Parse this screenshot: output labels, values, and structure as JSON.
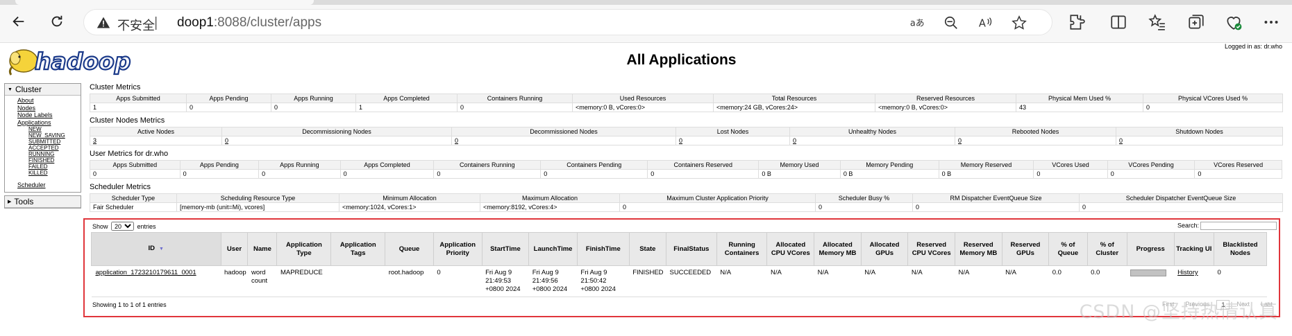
{
  "browser": {
    "insecure_label": "不安全",
    "separator": "|",
    "url_host": "doop1",
    "url_rest": ":8088/cluster/apps",
    "icons": [
      "back-icon",
      "refresh-icon",
      "warning-icon",
      "read-aloud-aa-icon",
      "zoom-out-icon",
      "read-aloud-icon",
      "favorite-star-icon",
      "extensions-icon",
      "split-screen-icon",
      "favorites-icon",
      "collections-icon",
      "browser-essentials-icon",
      "more-icon"
    ]
  },
  "header": {
    "logo_text": "hadoop",
    "title": "All Applications",
    "logged_in": "Logged in as: dr.who"
  },
  "sidebar": {
    "cluster_label": "Cluster",
    "links": [
      "About",
      "Nodes",
      "Node Labels",
      "Applications"
    ],
    "app_states": [
      "NEW",
      "NEW_SAVING",
      "SUBMITTED",
      "ACCEPTED",
      "RUNNING",
      "FINISHED",
      "FAILED",
      "KILLED"
    ],
    "scheduler": "Scheduler",
    "tools_label": "Tools"
  },
  "cluster_metrics": {
    "title": "Cluster Metrics",
    "headers": [
      "Apps Submitted",
      "Apps Pending",
      "Apps Running",
      "Apps Completed",
      "Containers Running",
      "Used Resources",
      "Total Resources",
      "Reserved Resources",
      "Physical Mem Used %",
      "Physical VCores Used %"
    ],
    "values": [
      "1",
      "0",
      "0",
      "1",
      "0",
      "<memory:0 B, vCores:0>",
      "<memory:24 GB, vCores:24>",
      "<memory:0 B, vCores:0>",
      "43",
      "0"
    ]
  },
  "node_metrics": {
    "title": "Cluster Nodes Metrics",
    "headers": [
      "Active Nodes",
      "Decommissioning Nodes",
      "Decommissioned Nodes",
      "Lost Nodes",
      "Unhealthy Nodes",
      "Rebooted Nodes",
      "Shutdown Nodes"
    ],
    "values": [
      "3",
      "0",
      "0",
      "0",
      "0",
      "0",
      "0"
    ]
  },
  "user_metrics": {
    "title": "User Metrics for dr.who",
    "headers": [
      "Apps Submitted",
      "Apps Pending",
      "Apps Running",
      "Apps Completed",
      "Containers Running",
      "Containers Pending",
      "Containers Reserved",
      "Memory Used",
      "Memory Pending",
      "Memory Reserved",
      "VCores Used",
      "VCores Pending",
      "VCores Reserved"
    ],
    "values": [
      "0",
      "0",
      "0",
      "0",
      "0",
      "0",
      "0",
      "0 B",
      "0 B",
      "0 B",
      "0",
      "0",
      "0"
    ]
  },
  "scheduler_metrics": {
    "title": "Scheduler Metrics",
    "headers": [
      "Scheduler Type",
      "Scheduling Resource Type",
      "Minimum Allocation",
      "Maximum Allocation",
      "Maximum Cluster Application Priority",
      "Scheduler Busy %",
      "RM Dispatcher EventQueue Size",
      "Scheduler Dispatcher EventQueue Size"
    ],
    "values": [
      "Fair Scheduler",
      "[memory-mb (unit=Mi), vcores]",
      "<memory:1024, vCores:1>",
      "<memory:8192, vCores:4>",
      "0",
      "0",
      "0",
      "0"
    ]
  },
  "apps": {
    "show_label": "Show",
    "page_size": "20",
    "entries_label": "entries",
    "search_label": "Search:",
    "headers": [
      "ID",
      "User",
      "Name",
      "Application Type",
      "Application Tags",
      "Queue",
      "Application Priority",
      "StartTime",
      "LaunchTime",
      "FinishTime",
      "State",
      "FinalStatus",
      "Running Containers",
      "Allocated CPU VCores",
      "Allocated Memory MB",
      "Allocated GPUs",
      "Reserved CPU VCores",
      "Reserved Memory MB",
      "Reserved GPUs",
      "% of Queue",
      "% of Cluster",
      "Progress",
      "Tracking UI",
      "Blacklisted Nodes"
    ],
    "row": {
      "id": "application_1723210179611_0001",
      "user": "hadoop",
      "name": "word count",
      "type": "MAPREDUCE",
      "tags": "",
      "queue": "root.hadoop",
      "priority": "0",
      "start": "Fri Aug 9 21:49:53 +0800 2024",
      "launch": "Fri Aug 9 21:49:56 +0800 2024",
      "finish": "Fri Aug 9 21:50:42 +0800 2024",
      "state": "FINISHED",
      "final_status": "SUCCEEDED",
      "running_containers": "N/A",
      "alloc_vcores": "N/A",
      "alloc_mem": "N/A",
      "alloc_gpus": "N/A",
      "res_vcores": "N/A",
      "res_mem": "N/A",
      "res_gpus": "N/A",
      "pct_queue": "0.0",
      "pct_cluster": "0.0",
      "progress": 1.0,
      "tracking": "History",
      "blacklisted": "0"
    },
    "info": "Showing 1 to 1 of 1 entries",
    "paging": [
      "First",
      "Previous",
      "1",
      "Next",
      "Last"
    ]
  },
  "watermark": "CSDN @坚持热情认真"
}
